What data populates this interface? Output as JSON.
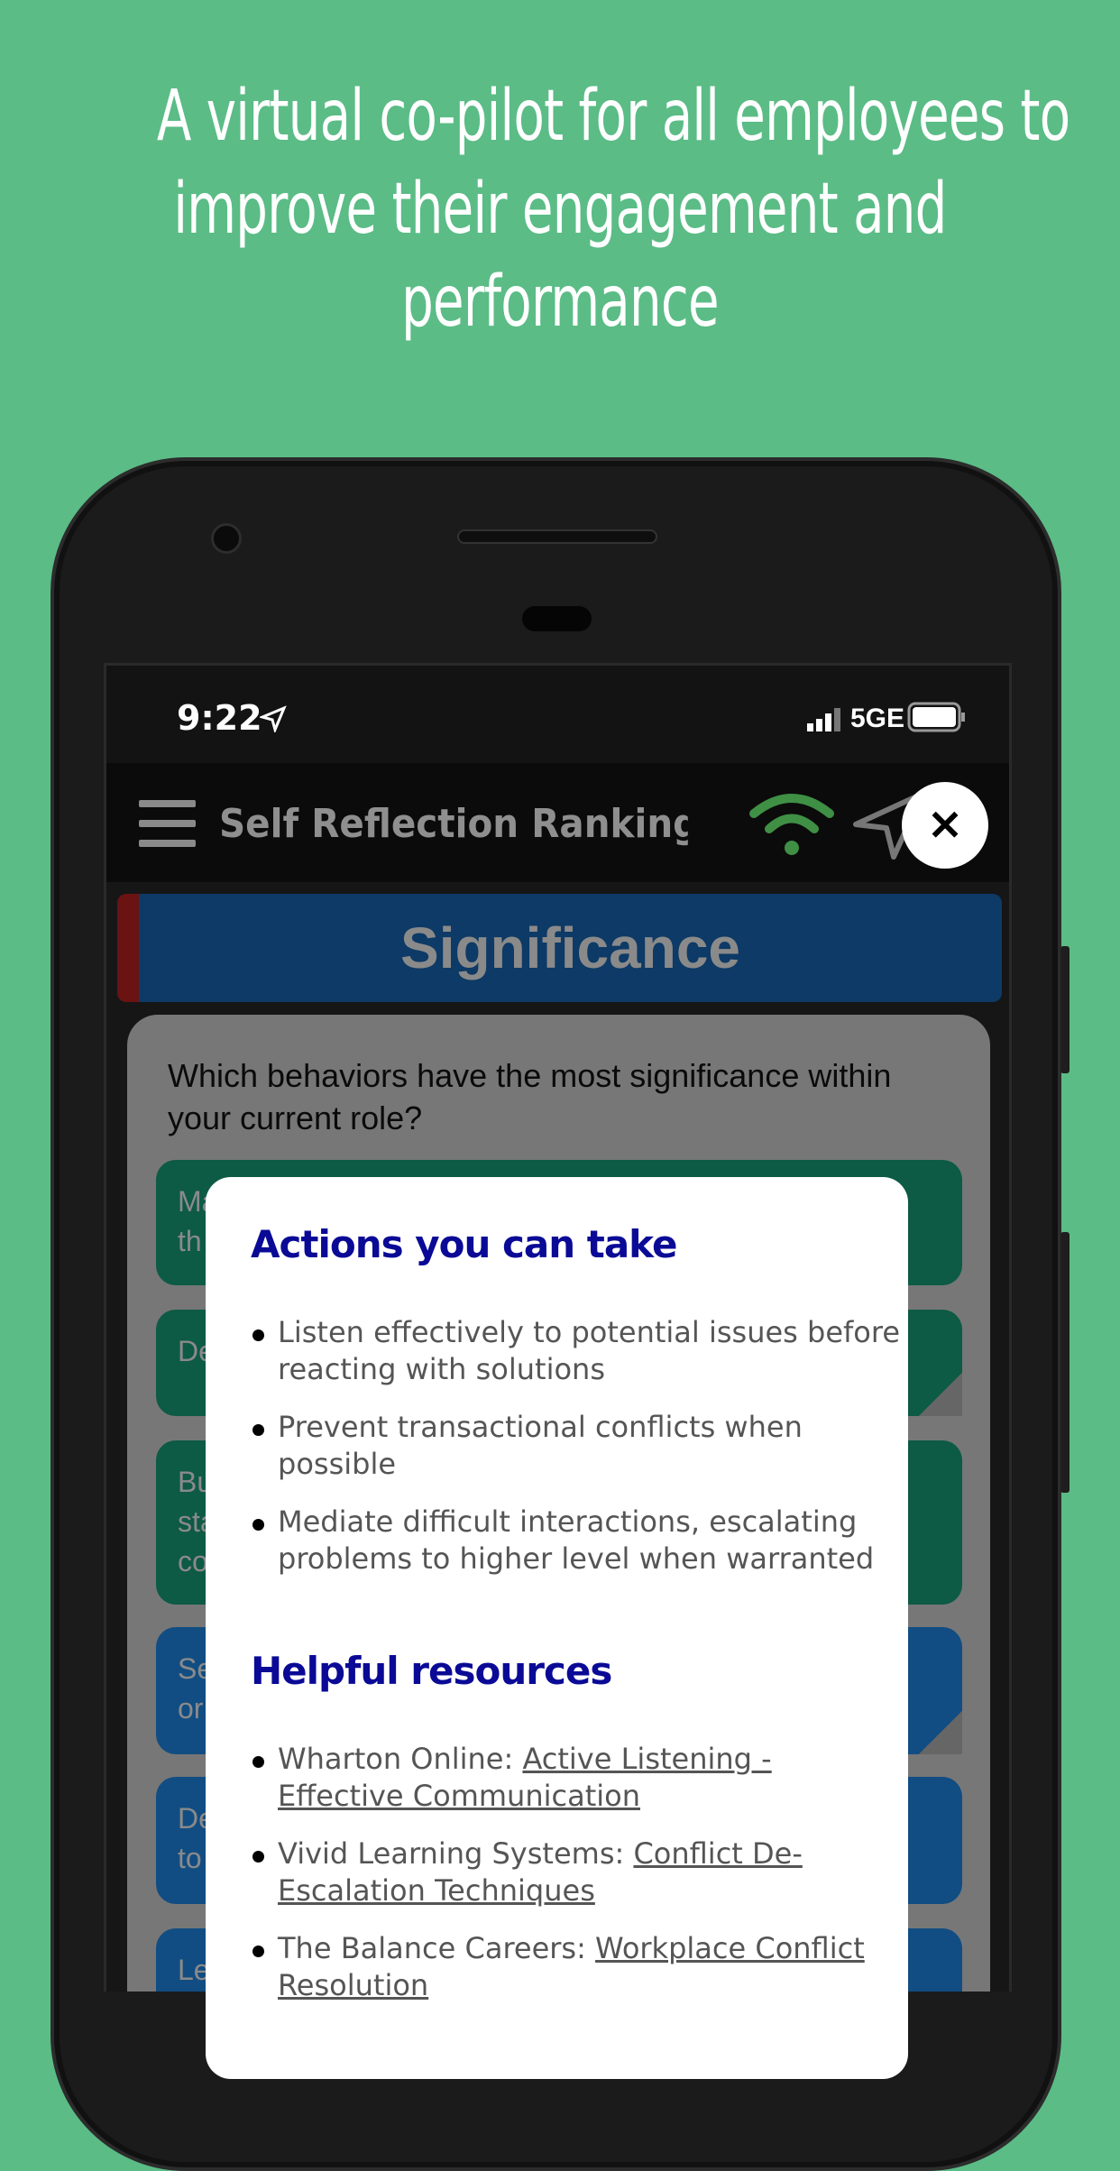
{
  "headline": [
    "A virtual co-pilot for all employees to",
    "improve their engagement and",
    "performance"
  ],
  "status_bar": {
    "time": "9:22",
    "network": "5GE"
  },
  "nav": {
    "title": "Self Reflection Ranking Too",
    "icons": [
      "hamburger-menu-icon",
      "wifi-icon",
      "location-arrow-icon"
    ]
  },
  "banner": {
    "title": "Significance"
  },
  "card": {
    "question": "Which behaviors have the most significance within your current role?",
    "options": [
      {
        "text": "Ma\nth",
        "color": "#0d5a45"
      },
      {
        "text": "De",
        "color": "#0d5a45"
      },
      {
        "text": "Bu\nsta\nco",
        "color": "#0d5a45"
      },
      {
        "text": "Se\nor",
        "color": "#114d82"
      },
      {
        "text": "De\nto",
        "color": "#114d82"
      },
      {
        "text": "Le",
        "color": "#114d82"
      }
    ]
  },
  "modal": {
    "actions_title": "Actions you can take",
    "actions": [
      "Listen effectively to potential issues before reacting with solutions",
      "Prevent transactional conflicts when possible",
      "Mediate difficult interactions, escalating problems to higher level when warranted"
    ],
    "resources_title": "Helpful resources",
    "resources": [
      {
        "source": "Wharton Online: ",
        "link": "Active Listening - Effective Communication"
      },
      {
        "source": "Vivid Learning Systems: ",
        "link": "Conflict De-Escalation Techniques"
      },
      {
        "source": "The Balance Careers: ",
        "link": "Workplace Conflict Resolution"
      }
    ],
    "close_label": "✕"
  },
  "colors": {
    "background": "#5bbc86",
    "heading": "#0a0a96",
    "wifi": "#3f8f45"
  }
}
